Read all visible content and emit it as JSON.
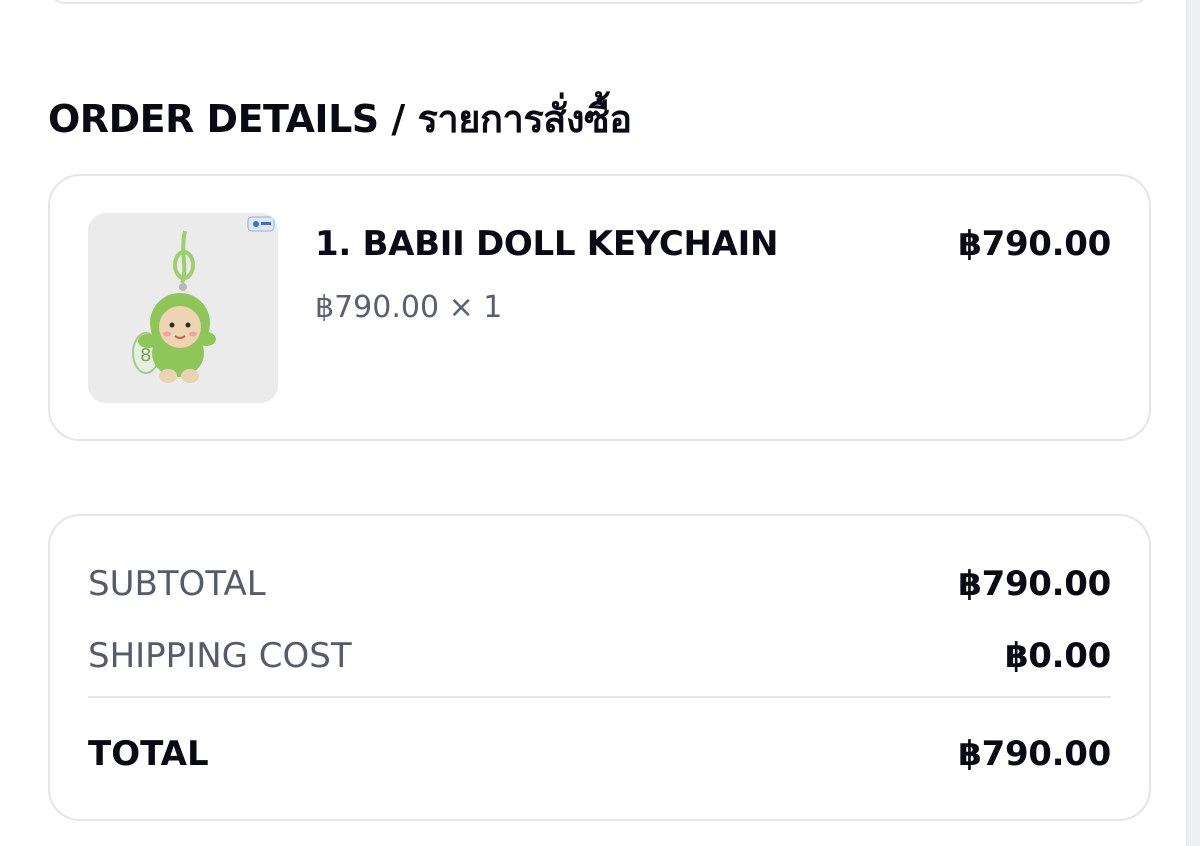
{
  "order": {
    "title": "ORDER DETAILS / รายการสั่งซื้อ",
    "items": [
      {
        "name": "1. BABII DOLL KEYCHAIN",
        "unit_price_qty": "฿790.00 × 1",
        "price": "฿790.00",
        "image": "green-doll-keychain"
      }
    ]
  },
  "summary": {
    "subtotal_label": "SUBTOTAL",
    "subtotal_value": "฿790.00",
    "shipping_label": "SHIPPING COST",
    "shipping_value": "฿0.00",
    "total_label": "TOTAL",
    "total_value": "฿790.00"
  },
  "colors": {
    "text_primary": "#0a0a14",
    "text_secondary": "#545b6b",
    "border": "#e4e5e9",
    "product_bg": "#ebebeb",
    "product_green": "#8fc65a"
  }
}
